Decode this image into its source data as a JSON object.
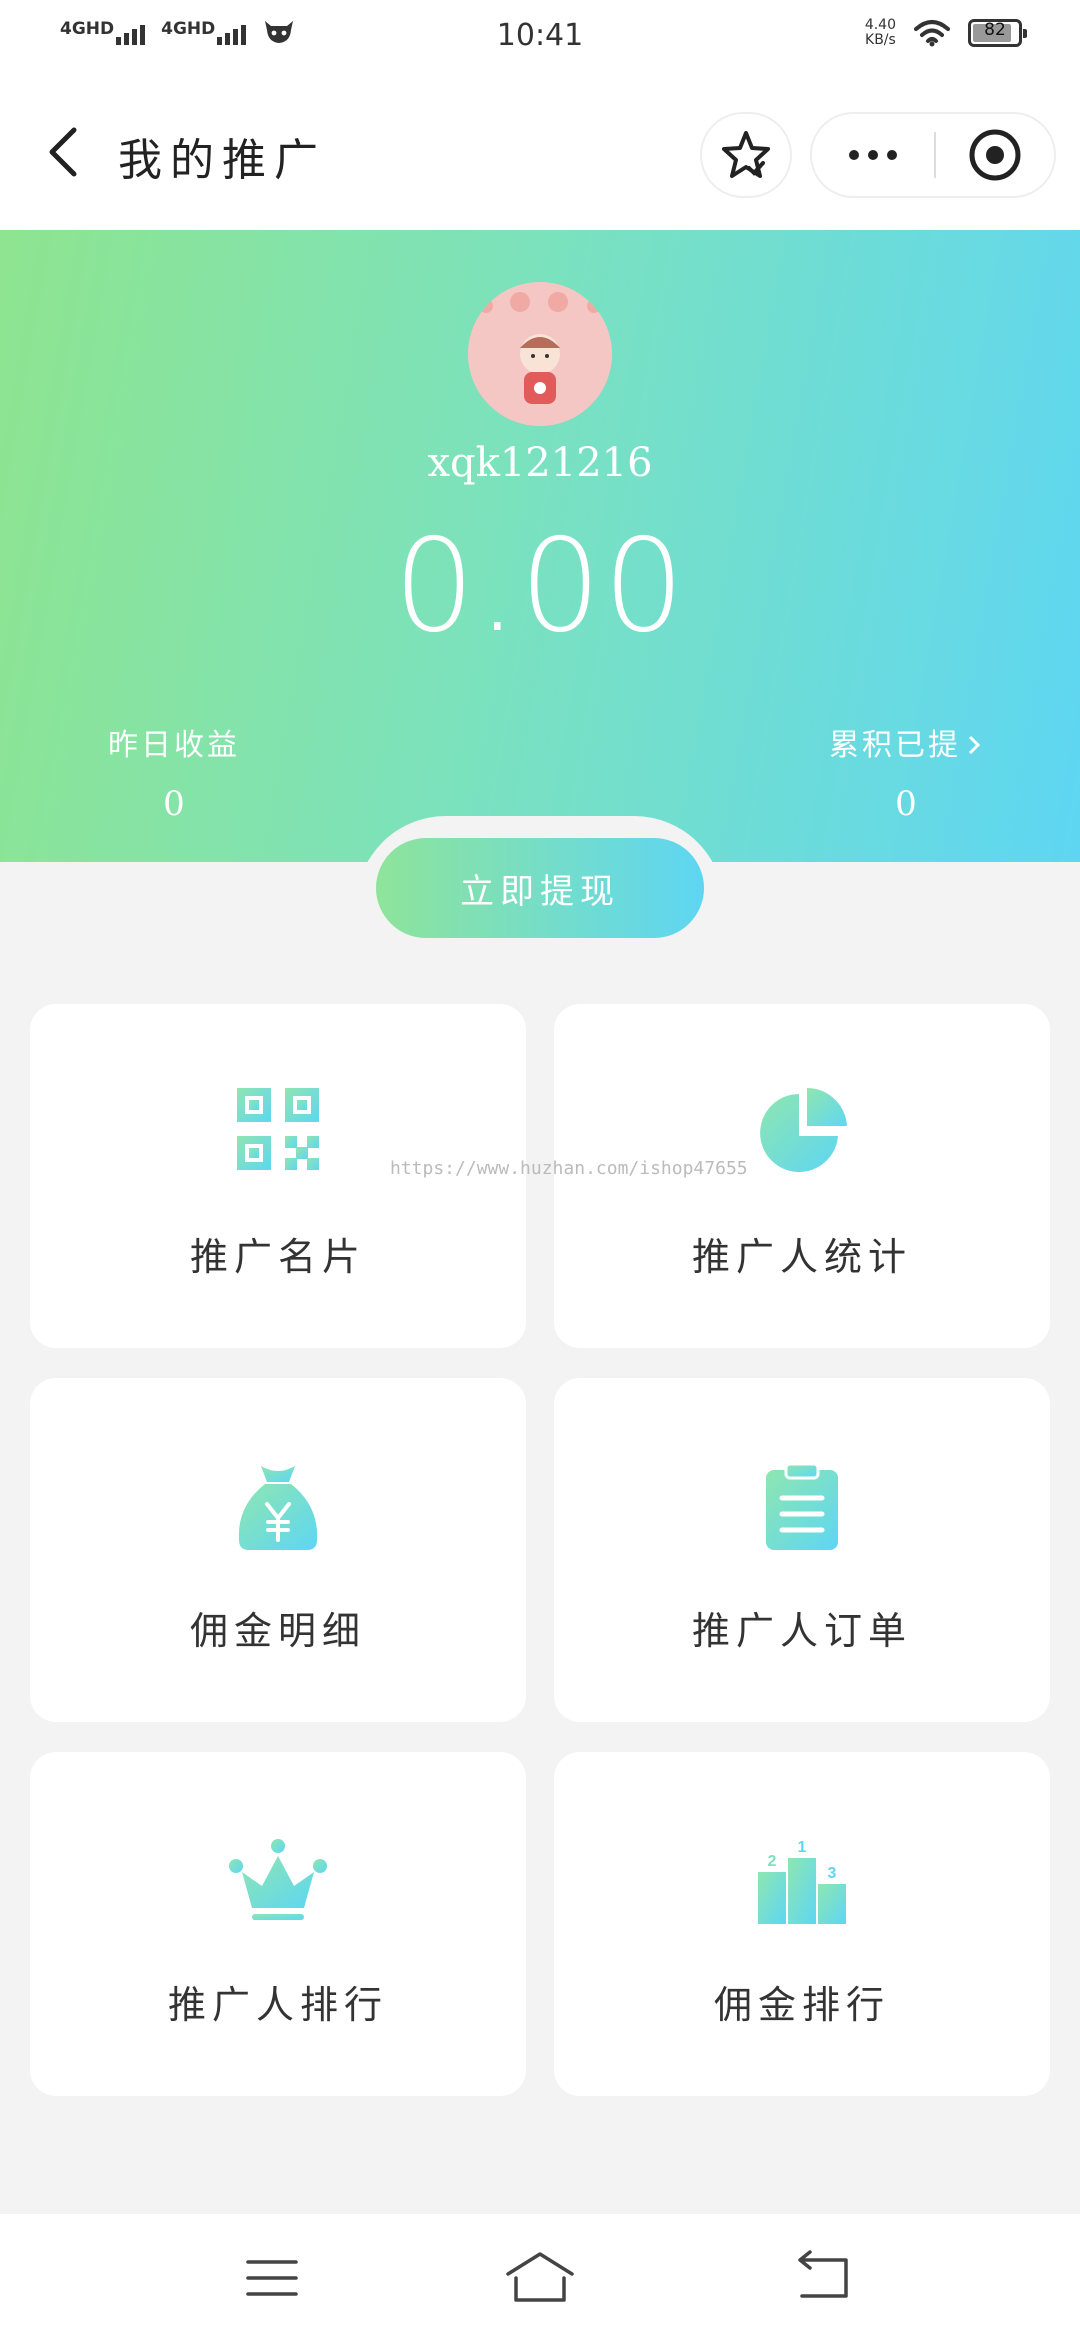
{
  "status": {
    "net1": "4GHD",
    "net2": "4GHD",
    "time": "10:41",
    "speed_value": "4.40",
    "speed_unit": "KB/s",
    "battery": "82"
  },
  "nav": {
    "title": "我的推广"
  },
  "profile": {
    "username": "xqk121216",
    "balance": "0.00",
    "yesterday_label": "昨日收益",
    "yesterday_value": "0",
    "withdrawn_label": "累积已提",
    "withdrawn_value": "0"
  },
  "withdraw_button": "立即提现",
  "menu": [
    {
      "label": "推广名片",
      "icon": "qrcode-icon"
    },
    {
      "label": "推广人统计",
      "icon": "pie-chart-icon"
    },
    {
      "label": "佣金明细",
      "icon": "money-bag-icon"
    },
    {
      "label": "推广人订单",
      "icon": "clipboard-icon"
    },
    {
      "label": "推广人排行",
      "icon": "crown-icon"
    },
    {
      "label": "佣金排行",
      "icon": "podium-icon"
    }
  ],
  "podium_numbers": [
    "1",
    "2",
    "3"
  ],
  "watermark": "https://www.huzhan.com/ishop47655",
  "colors": {
    "gradient_start": "#8ee48f",
    "gradient_end": "#5ed6f3",
    "icon_start": "#8ee6b0",
    "icon_end": "#5ed6f3"
  }
}
